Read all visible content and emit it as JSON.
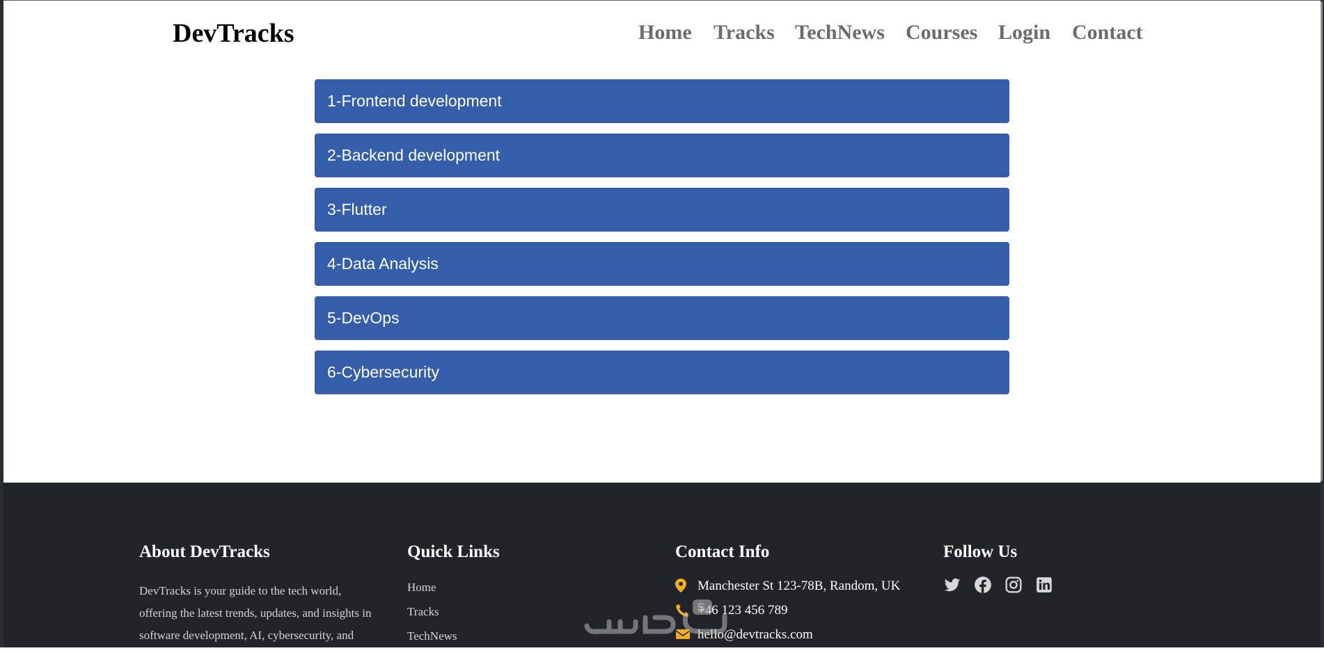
{
  "header": {
    "brand": "DevTracks",
    "nav": [
      "Home",
      "Tracks",
      "TechNews",
      "Courses",
      "Login",
      "Contact"
    ]
  },
  "tracks": [
    "1-Frontend development",
    "2-Backend development",
    "3-Flutter",
    "4-Data Analysis",
    "5-DevOps",
    "6-Cybersecurity"
  ],
  "footer": {
    "about": {
      "title": "About DevTracks",
      "text_lines": [
        "DevTracks is your guide to the tech world,",
        "offering the latest trends, updates, and insights in",
        "software development, AI, cybersecurity, and"
      ]
    },
    "quick_links": {
      "title": "Quick Links",
      "items": [
        "Home",
        "Tracks",
        "TechNews"
      ]
    },
    "contact": {
      "title": "Contact Info",
      "address": "Manchester St 123-78B, Random, UK",
      "phone": "+46 123 456 789",
      "email": "hello@devtracks.com"
    },
    "follow": {
      "title": "Follow Us",
      "icons": [
        "twitter-icon",
        "facebook-icon",
        "instagram-icon",
        "linkedin-icon"
      ]
    }
  },
  "colors": {
    "track_bg": "#345daa",
    "footer_bg": "#212529",
    "nav_text": "#6c6c6c",
    "contact_icon": "#f2b01e"
  }
}
